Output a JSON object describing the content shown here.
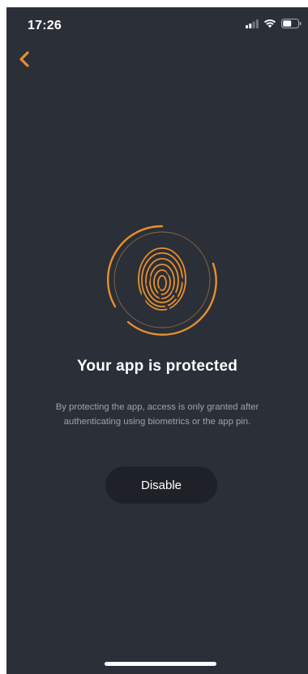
{
  "status_bar": {
    "time": "17:26",
    "icons": [
      "cellular-signal-icon",
      "wifi-icon",
      "battery-icon"
    ]
  },
  "navigation": {
    "back_icon": "chevron-left-icon"
  },
  "main": {
    "illustration_icon": "fingerprint-icon",
    "title": "Your app is protected",
    "description": "By protecting the app, access is only granted after authenticating using biometrics or the app pin.",
    "disable_label": "Disable"
  },
  "colors": {
    "background": "#2b2f38",
    "accent": "#e88f2c",
    "button_background": "#1e2228",
    "text_primary": "#ffffff",
    "text_secondary": "#9ea3ad"
  }
}
